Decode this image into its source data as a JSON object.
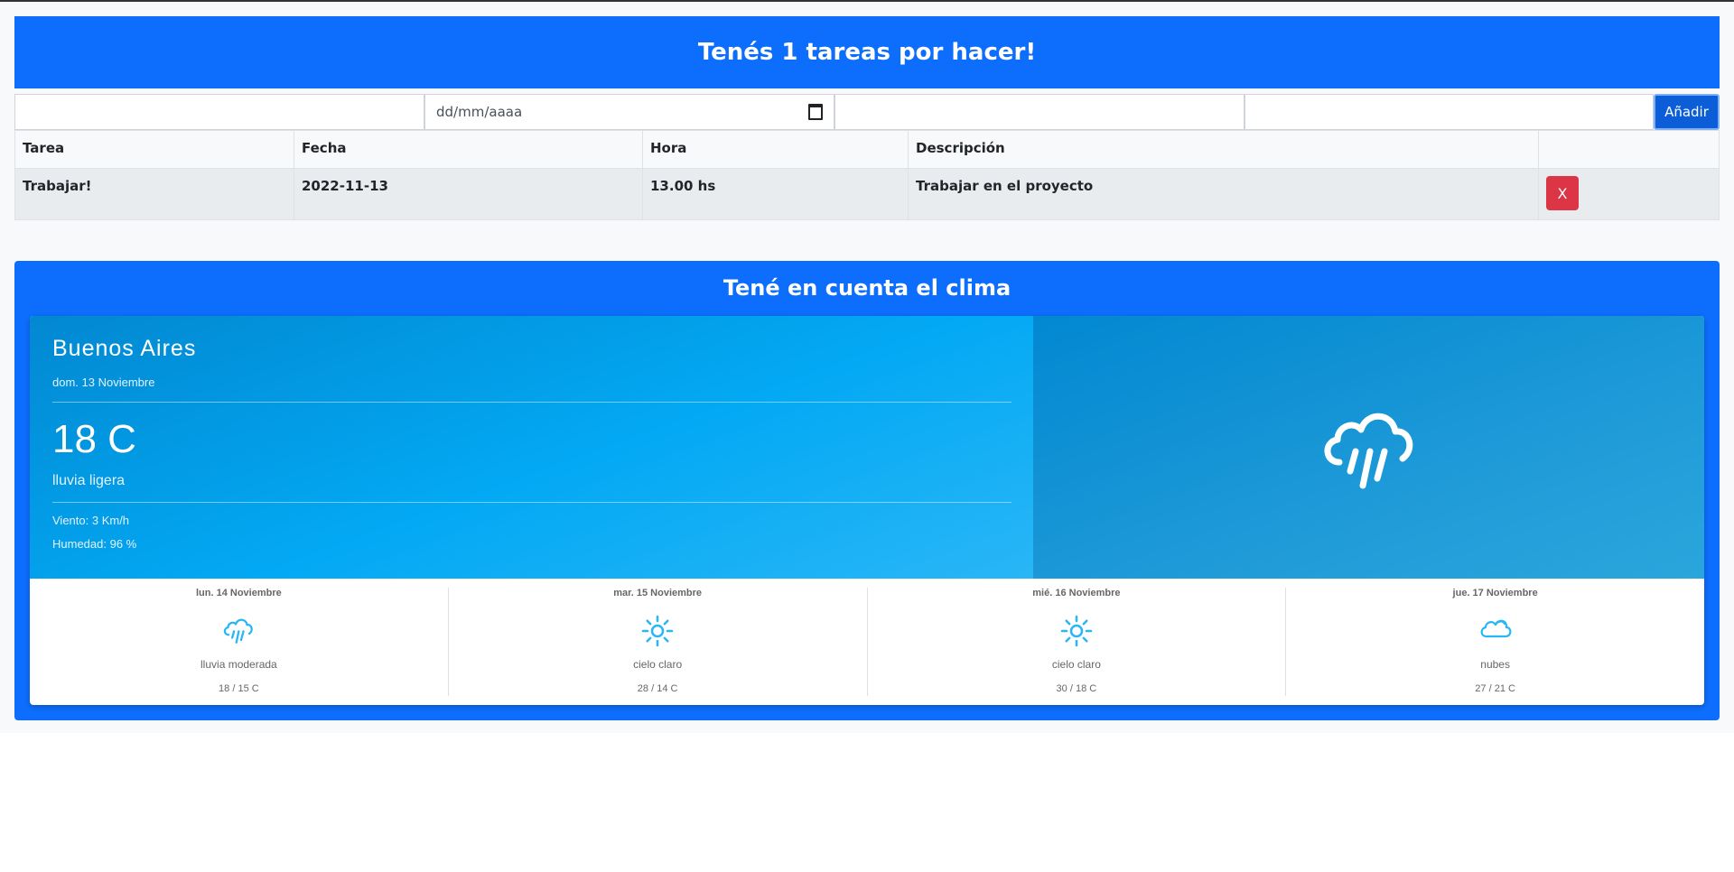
{
  "header": {
    "title": "Tenés 1 tareas por hacer!"
  },
  "form": {
    "task_value": "",
    "date_placeholder": "dd/mm/aaaa",
    "hour_value": "",
    "description_value": "",
    "add_label": "Añadir"
  },
  "table": {
    "columns": [
      "Tarea",
      "Fecha",
      "Hora",
      "Descripción",
      ""
    ],
    "rows": [
      {
        "task": "Trabajar!",
        "date": "2022-11-13",
        "hour": "13.00 hs",
        "description": "Trabajar en el proyecto",
        "delete_label": "X"
      }
    ]
  },
  "weather": {
    "section_title": "Tené en cuenta el clima",
    "city": "Buenos Aires",
    "date": "dom. 13 Noviembre",
    "temperature": "18 C",
    "description": "lluvia ligera",
    "wind": "Viento: 3 Km/h",
    "humidity": "Humedad: 96 %",
    "icon": "rain-cloud-icon",
    "forecast": [
      {
        "date": "lun. 14 Noviembre",
        "icon": "rain-cloud-icon",
        "description": "lluvia moderada",
        "temps": "18 / 15 C"
      },
      {
        "date": "mar. 15 Noviembre",
        "icon": "sun-icon",
        "description": "cielo claro",
        "temps": "28 / 14 C"
      },
      {
        "date": "mié. 16 Noviembre",
        "icon": "sun-icon",
        "description": "cielo claro",
        "temps": "30 / 18 C"
      },
      {
        "date": "jue. 17 Noviembre",
        "icon": "clouds-icon",
        "description": "nubes",
        "temps": "27 / 21 C"
      }
    ]
  },
  "colors": {
    "primary": "#0d6efd",
    "danger": "#dc3545",
    "weather_blue": "#03a9f4",
    "icon_blue": "#29b6f6"
  }
}
